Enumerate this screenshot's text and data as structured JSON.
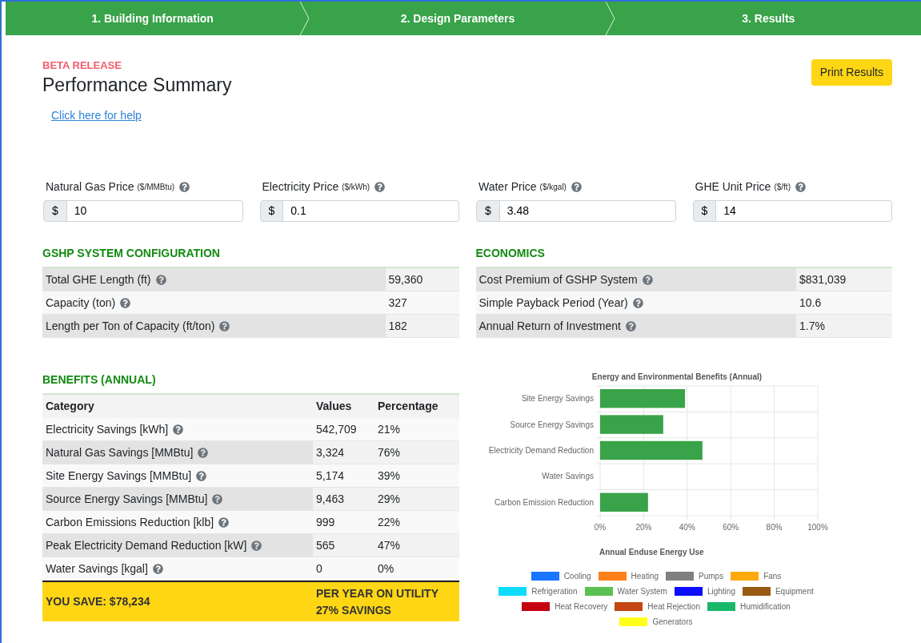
{
  "steps": [
    {
      "label": "1. Building Information"
    },
    {
      "label": "2. Design Parameters"
    },
    {
      "label": "3. Results"
    }
  ],
  "release_tag": "BETA RELEASE",
  "title": "Performance Summary",
  "print_button": "Print Results",
  "help_link": "Click here for help",
  "prices": [
    {
      "label": "Natural Gas Price",
      "unit": "($/MMBtu)",
      "prefix": "$",
      "value": "10"
    },
    {
      "label": "Electricity Price",
      "unit": "($/kWh)",
      "prefix": "$",
      "value": "0.1"
    },
    {
      "label": "Water Price",
      "unit": "($/kgal)",
      "prefix": "$",
      "value": "3.48"
    },
    {
      "label": "GHE Unit Price",
      "unit": "($/ft)",
      "prefix": "$",
      "value": "14"
    }
  ],
  "config": {
    "title": "GSHP SYSTEM CONFIGURATION",
    "rows": [
      {
        "label": "Total GHE Length (ft)",
        "value": "59,360"
      },
      {
        "label": "Capacity (ton)",
        "value": "327"
      },
      {
        "label": "Length per Ton of Capacity (ft/ton)",
        "value": "182"
      }
    ]
  },
  "economics": {
    "title": "ECONOMICS",
    "rows": [
      {
        "label": "Cost Premium of GSHP System",
        "value": "$831,039"
      },
      {
        "label": "Simple Payback Period (Year)",
        "value": "10.6"
      },
      {
        "label": "Annual Return of Investment",
        "value": "1.7%"
      }
    ]
  },
  "benefits": {
    "title": "BENEFITS (ANNUAL)",
    "columns": [
      "Category",
      "Values",
      "Percentage"
    ],
    "rows": [
      {
        "category": "Electricity Savings [kWh]",
        "value": "542,709",
        "percentage": "21%"
      },
      {
        "category": "Natural Gas Savings [MMBtu]",
        "value": "3,324",
        "percentage": "76%"
      },
      {
        "category": "Site Energy Savings [MMBtu]",
        "value": "5,174",
        "percentage": "39%"
      },
      {
        "category": "Source Energy Savings [MMBtu]",
        "value": "9,463",
        "percentage": "29%"
      },
      {
        "category": "Carbon Emissions Reduction [klb]",
        "value": "999",
        "percentage": "22%"
      },
      {
        "category": "Peak Electricity Demand Reduction [kW]",
        "value": "565",
        "percentage": "47%"
      },
      {
        "category": "Water Savings [kgal]",
        "value": "0",
        "percentage": "0%"
      }
    ],
    "savings": "YOU SAVE: $78,234",
    "savings_note": [
      "PER YEAR ON UTILITY",
      "27% SAVINGS"
    ]
  },
  "benefits_chart": {
    "chart_data": {
      "type": "bar",
      "orientation": "horizontal",
      "title": "Energy and Environmental Benefits (Annual)",
      "categories": [
        "Site Energy Savings",
        "Source Energy Savings",
        "Electricity Demand Reduction",
        "Water Savings",
        "Carbon Emission Reduction"
      ],
      "series": [
        {
          "color": "#38a349",
          "values": [
            39,
            29,
            47,
            0,
            22
          ]
        }
      ],
      "grid": true,
      "xlim": [
        0,
        100
      ],
      "xticks": [
        {
          "value": 0,
          "label": "0%"
        },
        {
          "value": 20,
          "label": "20%"
        },
        {
          "value": 40,
          "label": "40%"
        },
        {
          "value": 60,
          "label": "60%"
        },
        {
          "value": 80,
          "label": "80%"
        },
        {
          "value": 100,
          "label": "100%"
        }
      ]
    }
  },
  "enduse_chart": {
    "title": "Annual Enduse Energy Use",
    "legend": [
      {
        "label": "Cooling",
        "color": "#1a75ff"
      },
      {
        "label": "Heating",
        "color": "#ff8019"
      },
      {
        "label": "Pumps",
        "color": "#7f7f7f"
      },
      {
        "label": "Fans",
        "color": "#ffa90d"
      },
      {
        "label": "Refrigeration",
        "color": "#0ddcff"
      },
      {
        "label": "Water System",
        "color": "#5cc152"
      },
      {
        "label": "Lighting",
        "color": "#0d0dff"
      },
      {
        "label": "Equipment",
        "color": "#9a5a12"
      },
      {
        "label": "Heat Recovery",
        "color": "#c50010"
      },
      {
        "label": "Heat Rejection",
        "color": "#c24512"
      },
      {
        "label": "Humidification",
        "color": "#18b76a"
      },
      {
        "label": "Generators",
        "color": "#ffff19"
      }
    ]
  }
}
